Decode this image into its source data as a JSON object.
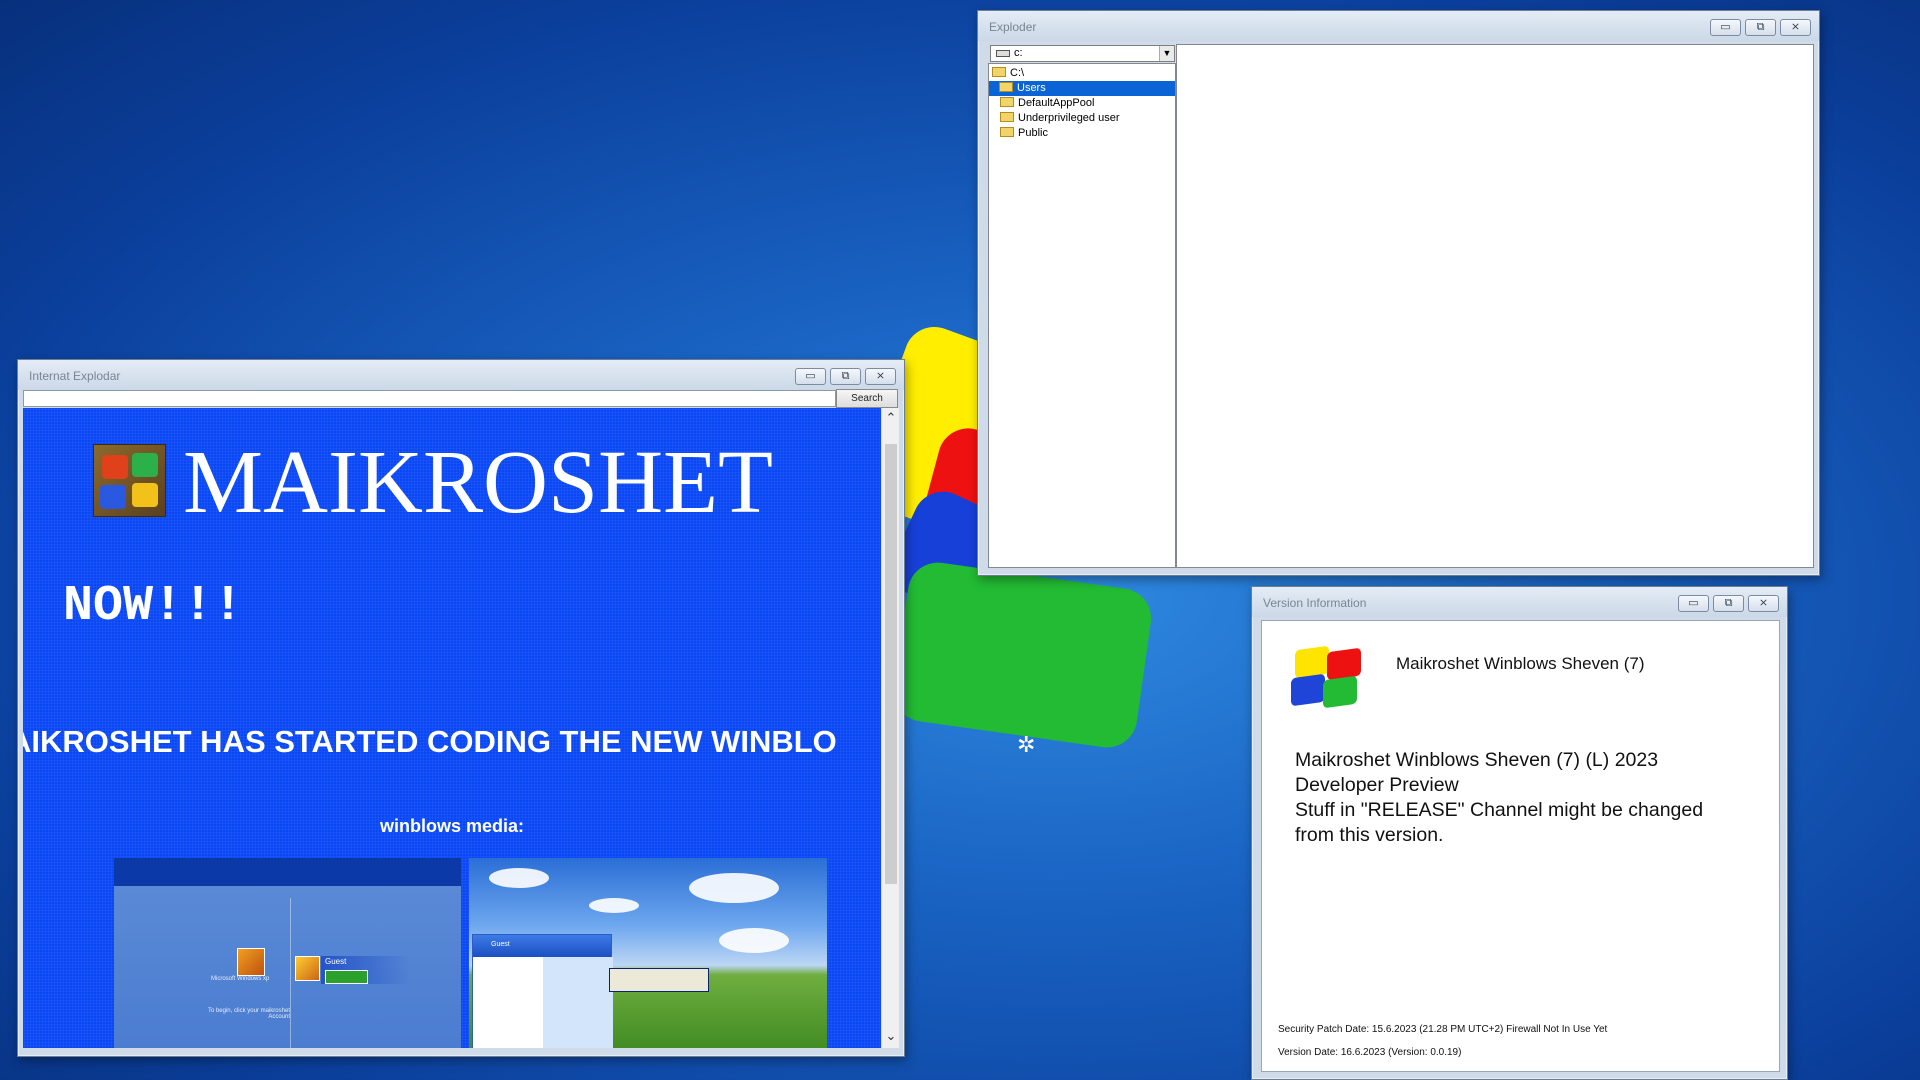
{
  "desktop": {
    "wallpaper_colors": {
      "blue": "#1a64c4",
      "yellow": "#ffee00",
      "red": "#ee1111",
      "green": "#22bb33"
    }
  },
  "ie_window": {
    "title": "Internat Explodar",
    "controls": {
      "minimize": "▭",
      "maximize": "⧉",
      "close": "⨯"
    },
    "url_value": "",
    "search_label": "Search",
    "page": {
      "brand_title": "MAIKROSHET",
      "now_text": "NOW!!!",
      "marquee_text": "AIKROSHET HAS STARTED CODING THE NEW WINBLO",
      "media_label": "winblows media:",
      "shot1": {
        "label": "Microsoft Windows xp",
        "guest": "Guest",
        "hint": "To begin, click your maikroshet Account"
      },
      "shot2": {
        "menu_user": "Guest"
      }
    },
    "scroll_up": "⌃",
    "scroll_down": "⌄"
  },
  "exploder_window": {
    "title": "Exploder",
    "controls": {
      "minimize": "▭",
      "maximize": "⧉",
      "close": "⨯"
    },
    "drive_value": "c:",
    "tree": [
      {
        "label": "C:\\",
        "selected": false,
        "depth": 0
      },
      {
        "label": "Users",
        "selected": true,
        "depth": 0
      },
      {
        "label": "DefaultAppPool",
        "selected": false,
        "depth": 1
      },
      {
        "label": "Underprivileged user",
        "selected": false,
        "depth": 1
      },
      {
        "label": "Public",
        "selected": false,
        "depth": 1
      }
    ]
  },
  "version_window": {
    "title": "Version Information",
    "controls": {
      "minimize": "▭",
      "maximize": "⧉",
      "close": "⨯"
    },
    "product_name": "Maikroshet Winblows Sheven (7)",
    "description": [
      "Maikroshet Winblows Sheven (7) (L) 2023",
      "Developer Preview",
      "Stuff in \"RELEASE\" Channel might be changed",
      "from this version."
    ],
    "security_patch": "Security Patch Date: 15.6.2023 (21.28 PM UTC+2) Firewall Not In Use Yet",
    "version_date": "Version Date: 16.6.2023 (Version: 0.0.19)"
  }
}
